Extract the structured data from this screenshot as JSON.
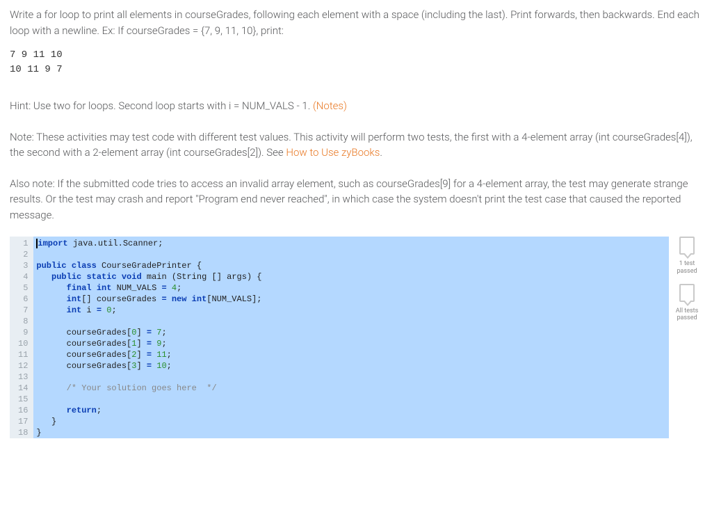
{
  "instructions": {
    "para1": "Write a for loop to print all elements in courseGrades, following each element with a space (including the last). Print forwards, then backwards. End each loop with a newline. Ex: If courseGrades = {7, 9, 11, 10}, print:",
    "example_output": "7 9 11 10\n10 11 9 7",
    "hint_prefix": "Hint: Use two for loops. Second loop starts with i = NUM_VALS - 1. ",
    "notes_link": "(Notes)",
    "note1_prefix": "Note: These activities may test code with different test values. This activity will perform two tests, the first with a 4-element array (int courseGrades[4]), the second with a 2-element array (int courseGrades[2]). See ",
    "note1_link": "How to Use zyBooks",
    "note1_suffix": ".",
    "note2": "Also note: If the submitted code tries to access an invalid array element, such as courseGrades[9] for a 4-element array, the test may generate strange results. Or the test may crash and report \"Program end never reached\", in which case the system doesn't print the test case that caused the reported message."
  },
  "code": {
    "l1_kw1": "import",
    "l1_rest": " java.util.Scanner;",
    "l3_kw1": "public",
    "l3_kw2": "class",
    "l3_name": " CourseGradePrinter {",
    "l4_kw1": "public",
    "l4_kw2": "static",
    "l4_kw3": "void",
    "l4_name": " main (String [] args) {",
    "l5_kw1": "final",
    "l5_kw2": "int",
    "l5_var": " NUM_VALS ",
    "l5_op": "=",
    "l5_num": " 4",
    "l5_end": ";",
    "l6_kw1": "int",
    "l6_arr": "[] courseGrades ",
    "l6_op": "=",
    "l6_kw2": " new",
    "l6_kw3": " int",
    "l6_rest": "[NUM_VALS];",
    "l7_kw1": "int",
    "l7_var": " i ",
    "l7_op": "=",
    "l7_num": " 0",
    "l7_end": ";",
    "l9": "courseGrades[",
    "l9_idx": "0",
    "l9_mid": "] ",
    "l9_op": "=",
    "l9_num": " 7",
    "l9_end": ";",
    "l10": "courseGrades[",
    "l10_idx": "1",
    "l10_mid": "] ",
    "l10_op": "=",
    "l10_num": " 9",
    "l10_end": ";",
    "l11": "courseGrades[",
    "l11_idx": "2",
    "l11_mid": "] ",
    "l11_op": "=",
    "l11_num": " 11",
    "l11_end": ";",
    "l12": "courseGrades[",
    "l12_idx": "3",
    "l12_mid": "] ",
    "l12_op": "=",
    "l12_num": " 10",
    "l12_end": ";",
    "l14_comment": "/* Your solution goes here  */",
    "l16_kw": "return",
    "l16_end": ";",
    "l17": "   }",
    "l18": "}"
  },
  "gutter": [
    "1",
    "2",
    "3",
    "4",
    "5",
    "6",
    "7",
    "8",
    "9",
    "10",
    "11",
    "12",
    "13",
    "14",
    "15",
    "16",
    "17",
    "18"
  ],
  "side": {
    "badge1": "1 test\npassed",
    "badge2": "All tests\npassed"
  }
}
